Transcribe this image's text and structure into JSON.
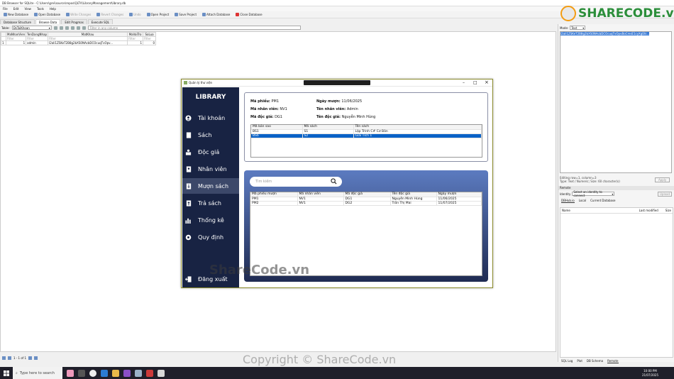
{
  "window": {
    "title": "DB Browser for SQLite - C:\\Users\\grei\\source\\repos\\QLTV\\LibraryManagement\\library.db"
  },
  "menu": [
    "File",
    "Edit",
    "View",
    "Tools",
    "Help"
  ],
  "toolbar": [
    "New Database",
    "Open Database",
    "Write Changes",
    "Revert Changes",
    "Undo",
    "Open Project",
    "Save Project",
    "Attach Database",
    "Close Database"
  ],
  "tabs": [
    "Database Structure",
    "Browse Data",
    "Edit Pragmas",
    "Execute SQL"
  ],
  "table_bar": {
    "label": "Table:",
    "selected": "DsTaiKhoan",
    "filter_placeholder": "Filter in any column"
  },
  "grid": {
    "columns": [
      "MaNhanVien",
      "TenDangNhap",
      "MatKhau",
      "MaVaiTro",
      "SoLua"
    ],
    "filters": [
      "Filter",
      "Filter",
      "Filter",
      "Filter",
      "Filter"
    ],
    "rows": [
      [
        "1",
        "1",
        "admin",
        "I2aIi1ZSKeT2B8g2bXS0NAcbDCOcuqTvOpv...",
        "1",
        "0"
      ]
    ]
  },
  "status": {
    "page": "1 - 1 of 1"
  },
  "right": {
    "mode_label": "Mode:",
    "mode_value": "Text",
    "editor_value": "I2aIi1ZSKeT2B8g2bXS0NAcbDCOcuqTvOpvBoCmsE1cyXgEhi...",
    "editing_info": "Editing row=1, column=3",
    "type_info": "Type: Text / Numeric; Size: 60 character(s)",
    "apply": "Apply",
    "remote_title": "Remote",
    "identity_label": "Identity",
    "identity_value": "Select an identity to connect",
    "upload": "Upload",
    "remote_tabs": [
      "DBHub.io",
      "Local",
      "Current Database"
    ],
    "cols": [
      "Name",
      "Last modified",
      "Size"
    ],
    "bottom_tabs": [
      "SQL Log",
      "Plot",
      "DB Schema",
      "Remote"
    ]
  },
  "taskbar": {
    "search_placeholder": "Type here to search",
    "time": "10:00 PM",
    "date": "21/07/2025"
  },
  "logo": {
    "text": "SHARECODE.vn"
  },
  "watermark": "ShareCode.vn",
  "copyright": "Copyright © ShareCode.vn",
  "app": {
    "title": "Quản lý thư viện",
    "brand": "LIBRARY",
    "nav": [
      "Tài khoản",
      "Sách",
      "Độc giả",
      "Nhân viên",
      "Mượn sách",
      "Trả sách",
      "Thống kê",
      "Quy định",
      "Đăng xuất"
    ],
    "detail": {
      "ma_phieu_label": "Mã phiếu:",
      "ma_phieu": "PM1",
      "ngay_muon_label": "Ngày mượn:",
      "ngay_muon": "11/06/2025",
      "ma_nv_label": "Mã nhân viên:",
      "ma_nv": "NV1",
      "ten_nv_label": "Tên nhân viên:",
      "ten_nv": "Admin",
      "ma_dg_label": "Mã độc giả:",
      "ma_dg": "DG1",
      "ten_dg_label": "Tên độc giả:",
      "ten_dg": "Nguyễn Minh Hùng"
    },
    "book_table": {
      "columns": [
        "Mã bản sao",
        "Mã sách",
        "Tên sách"
      ],
      "rows": [
        [
          "BS1",
          "S1",
          "Lập Trình C# Cơ Bản"
        ],
        [
          "BS6",
          "S2",
          "Giải Tích 1"
        ]
      ]
    },
    "search_placeholder": "Tìm kiếm",
    "loan_table": {
      "columns": [
        "Mã phiếu mượn",
        "Mã nhân viên",
        "Mã độc giả",
        "Tên độc giả",
        "Ngày mượn"
      ],
      "rows": [
        [
          "PM1",
          "NV1",
          "DG1",
          "Nguyễn Minh Hùng",
          "11/06/2025"
        ],
        [
          "PM2",
          "NV1",
          "DG2",
          "Trần Thị Mai",
          "11/07/2025"
        ]
      ]
    }
  }
}
